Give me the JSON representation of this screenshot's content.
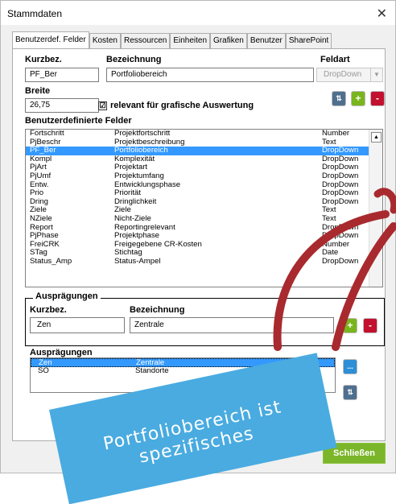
{
  "window": {
    "title": "Stammdaten",
    "close": "✕"
  },
  "tabs": [
    "Benutzerdef. Felder",
    "Kosten",
    "Ressourcen",
    "Einheiten",
    "Grafiken",
    "Benutzer",
    "SharePoint"
  ],
  "form": {
    "kurzbez_label": "Kurzbez.",
    "bezeichnung_label": "Bezeichnung",
    "feldart_label": "Feldart",
    "kurzbez_value": "PF_Ber",
    "bezeichnung_value": "Portfoliobereich",
    "feldart_value": "DropDown",
    "breite_label": "Breite",
    "breite_value": "26,75",
    "relevant_label": "relevant für grafische Auswertung",
    "relevant_checked": "☑",
    "fields_label": "Benutzerdefinierte Felder"
  },
  "fields": [
    {
      "kurz": "Fortschritt",
      "bez": "Projektfortschritt",
      "art": "Number"
    },
    {
      "kurz": "PjBeschr",
      "bez": "Projektbeschreibung",
      "art": "Text"
    },
    {
      "kurz": "PF_Ber",
      "bez": "Portfoliobereich",
      "art": "DropDown"
    },
    {
      "kurz": "Kompl",
      "bez": "Komplexität",
      "art": "DropDown"
    },
    {
      "kurz": "PjArt",
      "bez": "Projektart",
      "art": "DropDown"
    },
    {
      "kurz": "PjUmf",
      "bez": "Projektumfang",
      "art": "DropDown"
    },
    {
      "kurz": "Entw.",
      "bez": "Entwicklungsphase",
      "art": "DropDown"
    },
    {
      "kurz": "Prio",
      "bez": "Priorität",
      "art": "DropDown"
    },
    {
      "kurz": "Dring",
      "bez": "Dringlichkeit",
      "art": "DropDown"
    },
    {
      "kurz": "Ziele",
      "bez": "Ziele",
      "art": "Text"
    },
    {
      "kurz": "NZiele",
      "bez": "Nicht-Ziele",
      "art": "Text"
    },
    {
      "kurz": "Report",
      "bez": "Reportingrelevant",
      "art": "DropDown"
    },
    {
      "kurz": "PjPhase",
      "bez": "Projektphase",
      "art": "DropDown"
    },
    {
      "kurz": "FreiCRK",
      "bez": "Freigegebene CR-Kosten",
      "art": "Number"
    },
    {
      "kurz": "STag",
      "bez": "Stichtag",
      "art": "Date"
    },
    {
      "kurz": "Status_Amp",
      "bez": "Status-Ampel",
      "art": "DropDown"
    }
  ],
  "auspraegungen": {
    "group_title": "Ausprägungen",
    "kurzbez_label": "Kurzbez.",
    "bezeichnung_label": "Bezeichnung",
    "kurzbez_value": "Zen",
    "bezeichnung_value": "Zentrale",
    "list_label": "Ausprägungen",
    "items": [
      {
        "kurz": "Zen",
        "bez": "Zentrale"
      },
      {
        "kurz": "SO",
        "bez": "Standorte"
      }
    ]
  },
  "buttons": {
    "sort": "⇅",
    "add": "+",
    "delete": "-",
    "more": "...",
    "close": "Schließen"
  },
  "overlay": {
    "note_text": "Portfoliobereich ist spezifisches"
  },
  "colors": {
    "accent_blue": "#3399ff",
    "add_green": "#79b51c",
    "delete_red": "#c3102f",
    "note_blue": "#49abe0",
    "arrow_red": "#a82a2e"
  }
}
